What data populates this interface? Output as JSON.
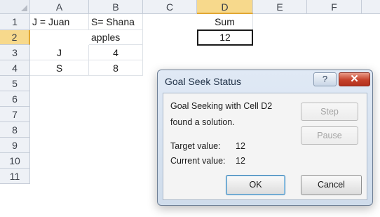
{
  "columns": [
    "A",
    "B",
    "C",
    "D",
    "E",
    "F"
  ],
  "rows": [
    "1",
    "2",
    "3",
    "4",
    "5",
    "6",
    "7",
    "8",
    "9",
    "10",
    "11"
  ],
  "cells": {
    "A1": "J = Juan",
    "B1": "S= Shana",
    "D1": "Sum",
    "B2": "apples",
    "D2": "12",
    "A3": "J",
    "B3": "4",
    "A4": "S",
    "B4": "8"
  },
  "dialog": {
    "title": "Goal Seek Status",
    "help_label": "?",
    "close_label": "✕",
    "message_line1": "Goal Seeking with Cell D2",
    "message_line2": "found a solution.",
    "target_label": "Target value:",
    "target_value": "12",
    "current_label": "Current value:",
    "current_value": "12",
    "step_label": "Step",
    "pause_label": "Pause",
    "ok_label": "OK",
    "cancel_label": "Cancel"
  },
  "colors": {
    "selected_header": "#f7d98c",
    "close_button": "#c5412b",
    "dialog_frame": "#cfdceb"
  }
}
